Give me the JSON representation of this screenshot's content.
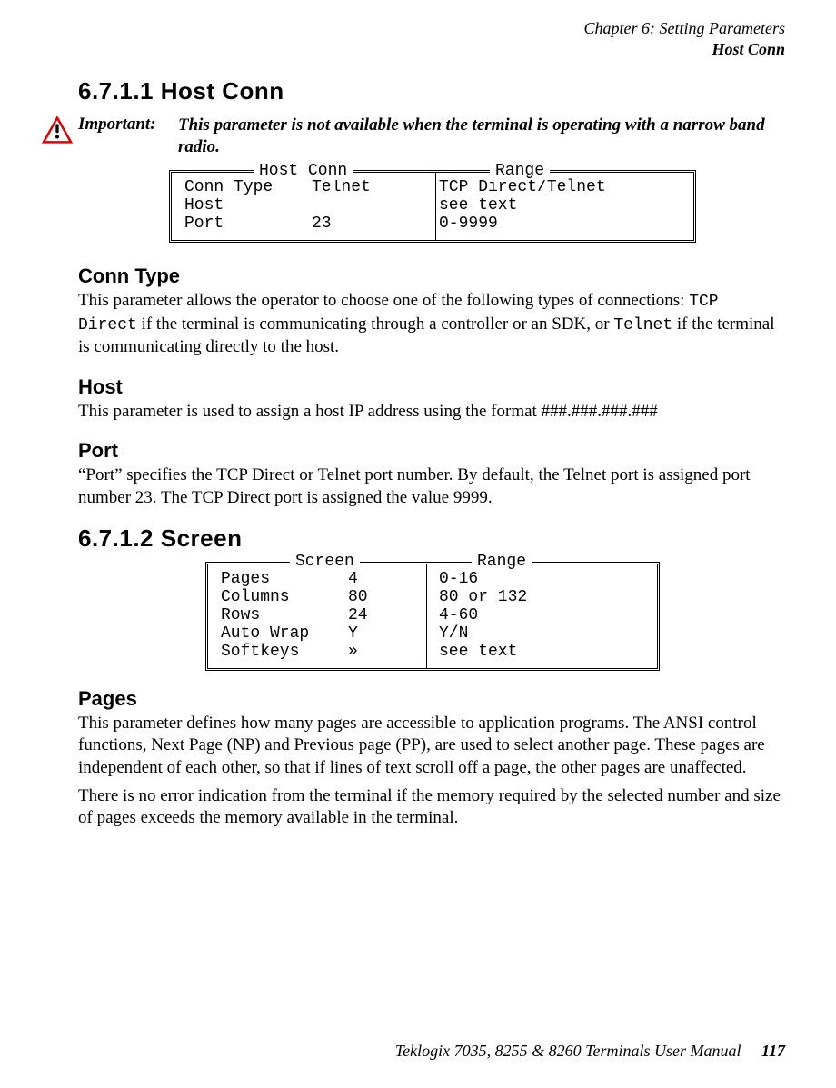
{
  "header": {
    "chapter": "Chapter 6: Setting Parameters",
    "section": "Host Conn"
  },
  "s1": {
    "heading": "6.7.1.1   Host Conn",
    "important_label": "Important:",
    "important_text": "This parameter is not available when the terminal is operating with a narrow band radio."
  },
  "diagram1": {
    "legend_left": "Host Conn",
    "legend_right": "Range",
    "rows": [
      {
        "name": "Conn Type",
        "val": "Telnet",
        "range": "TCP Direct/Telnet"
      },
      {
        "name": "Host",
        "val": "",
        "range": "see text"
      },
      {
        "name": "Port",
        "val": "23",
        "range": "0-9999"
      }
    ]
  },
  "conn_type": {
    "title": "Conn Type",
    "p_before": "This parameter allows the operator to choose one of the following types of connections: ",
    "code1": "TCP Direct",
    "p_mid": " if the terminal is communicating through a controller or an SDK, or ",
    "code2": "Telnet",
    "p_after": " if the terminal is communicating directly to the host."
  },
  "host": {
    "title": "Host",
    "p": "This parameter is used to assign a host IP address using the format ###.###.###.###"
  },
  "port": {
    "title": "Port",
    "p": "“Port” specifies the TCP Direct or Telnet port number. By default, the Telnet port is assigned port number 23. The TCP Direct port is assigned the value 9999."
  },
  "s2": {
    "heading": "6.7.1.2   Screen"
  },
  "diagram2": {
    "legend_left": "Screen",
    "legend_right": "Range",
    "rows": [
      {
        "name": "Pages",
        "val": "4",
        "range": "0-16"
      },
      {
        "name": "Columns",
        "val": "80",
        "range": "80 or 132"
      },
      {
        "name": "Rows",
        "val": "24",
        "range": "4-60"
      },
      {
        "name": "Auto Wrap",
        "val": "Y",
        "range": "Y/N"
      },
      {
        "name": "Softkeys",
        "val": "»",
        "range": "see text"
      }
    ]
  },
  "pages": {
    "title": "Pages",
    "p1": "This parameter defines how many pages are accessible to application programs. The ANSI control functions, Next Page (NP) and Previous page (PP), are used to select another page. These pages are independent of each other, so that if lines of text scroll off a page, the other pages are unaffected.",
    "p2": "There is no error indication from the terminal if the memory required by the selected number and size of pages exceeds the memory available in the terminal."
  },
  "footer": {
    "book": "Teklogix 7035, 8255 & 8260 Terminals User Manual",
    "page": "117"
  }
}
